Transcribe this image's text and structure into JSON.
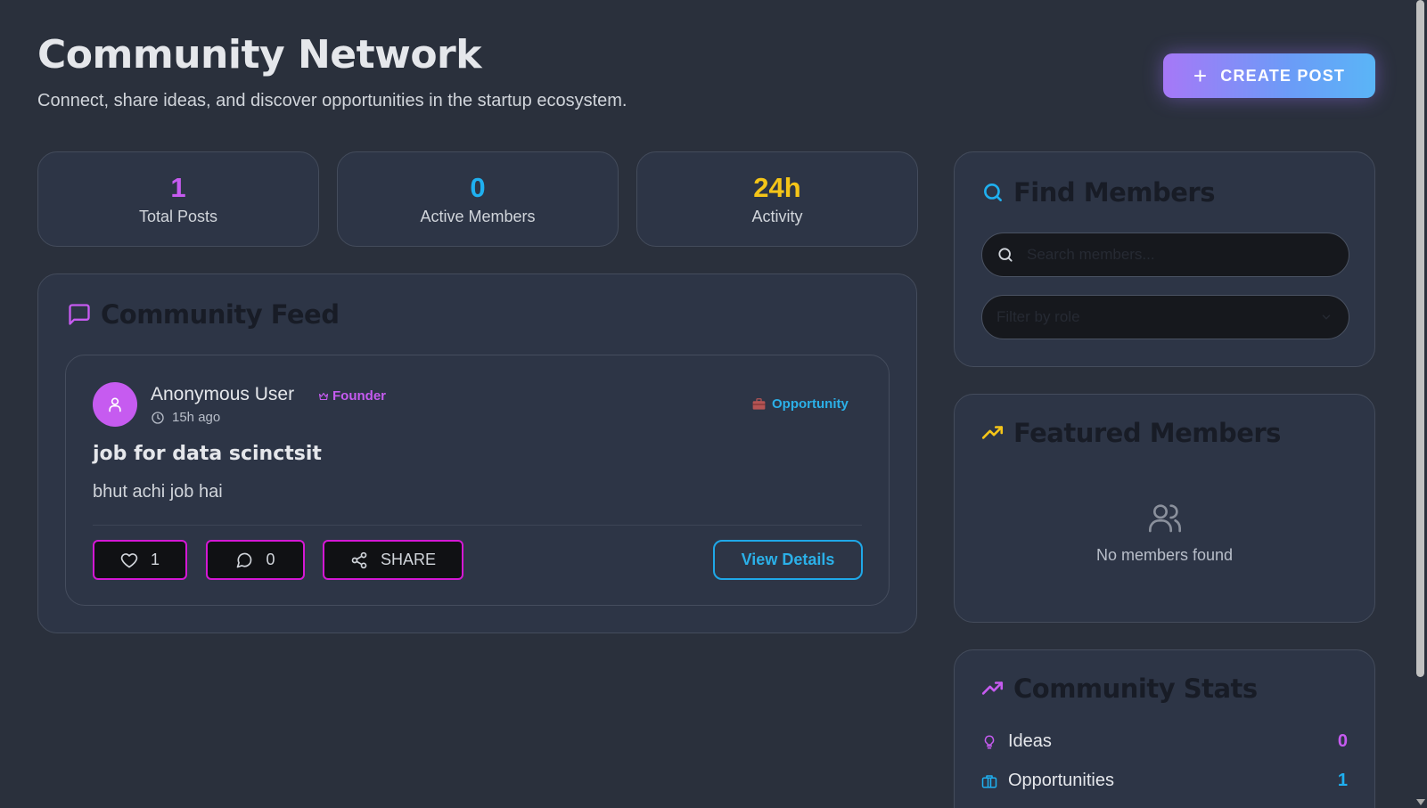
{
  "header": {
    "title": "Community Network",
    "subtitle": "Connect, share ideas, and discover opportunities in the startup ecosystem.",
    "create_button_label": "CREATE POST",
    "create_button_icon": "plus-icon"
  },
  "stats": [
    {
      "value": "1",
      "label": "Total Posts",
      "color": "#c65bf0"
    },
    {
      "value": "0",
      "label": "Active Members",
      "color": "#1fb0f0"
    },
    {
      "value": "24h",
      "label": "Activity",
      "color": "#f5c518"
    }
  ],
  "feed": {
    "title": "Community Feed",
    "icon": "message-square-icon",
    "post": {
      "author": "Anonymous User",
      "role": "Founder",
      "time": "15h ago",
      "type": "Opportunity",
      "title": "job for data scinctsit",
      "body": "bhut achi job hai",
      "likes": "1",
      "comments": "0",
      "share_label": "SHARE",
      "details_label": "View Details"
    }
  },
  "find_members": {
    "title": "Find Members",
    "search_placeholder": "Search members...",
    "filter_placeholder": "Filter by role"
  },
  "featured_members": {
    "title": "Featured Members",
    "empty_text": "No members found"
  },
  "community_stats": {
    "title": "Community Stats",
    "rows": [
      {
        "label": "Ideas",
        "value": "0",
        "icon": "lightbulb-icon",
        "color": "#c65bf0"
      },
      {
        "label": "Opportunities",
        "value": "1",
        "icon": "briefcase-icon",
        "color": "#1fb0f0"
      }
    ]
  },
  "colors": {
    "accent_purple": "#c65bf0",
    "accent_blue": "#1fb0f0",
    "accent_yellow": "#f5c518",
    "background": "#2a303c",
    "card": "#2d3546"
  }
}
